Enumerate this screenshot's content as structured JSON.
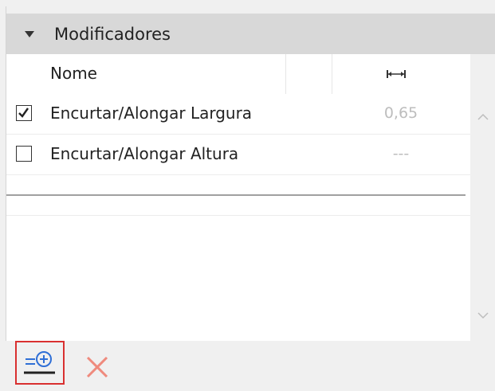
{
  "section": {
    "title": "Modificadores",
    "expand_icon": "triangle-down-icon"
  },
  "columns": {
    "name": "Nome",
    "width_icon": "horizontal-dimension-icon"
  },
  "rows": [
    {
      "checked": true,
      "label": "Encurtar/Alongar Largura",
      "value": "0,65"
    },
    {
      "checked": false,
      "label": "Encurtar/Alongar Altura",
      "value": "---"
    }
  ],
  "toolbar": {
    "add_icon": "add-modifier-icon",
    "delete_icon": "delete-x-icon"
  },
  "colors": {
    "header_bg": "#d8d8d8",
    "accent_blue": "#2f6fd6",
    "delete_red": "#ef8a7d",
    "highlight_border": "#d93030"
  }
}
